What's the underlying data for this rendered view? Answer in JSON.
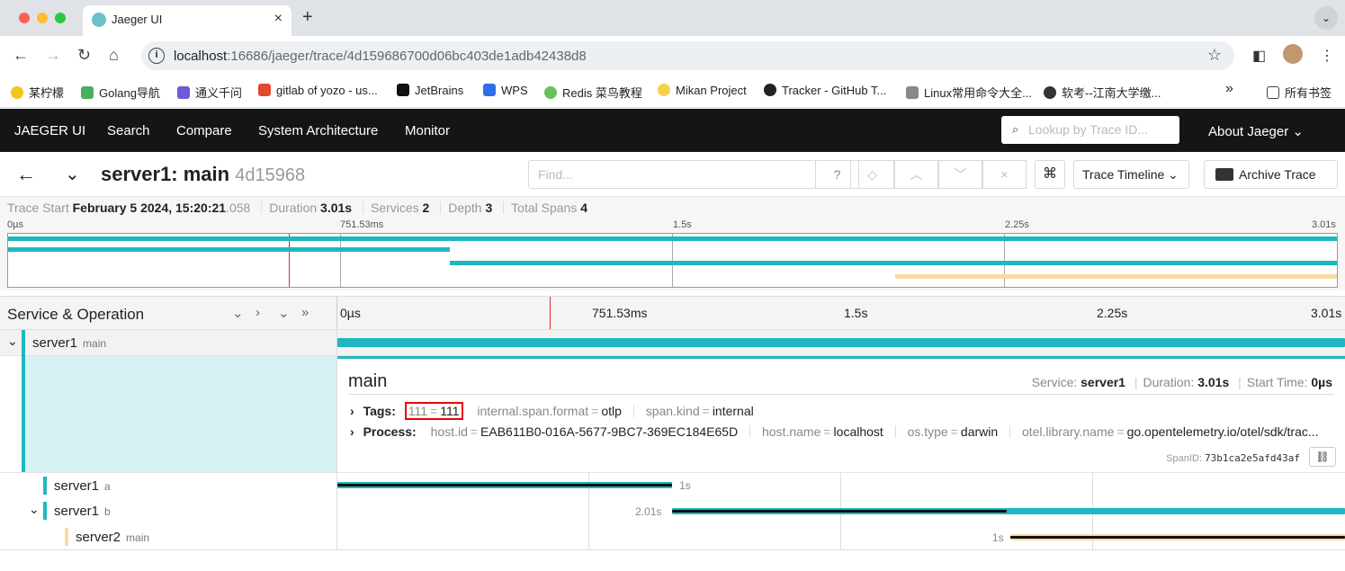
{
  "browser": {
    "tab_title": "Jaeger UI",
    "url_host": "localhost",
    "url_rest": ":16686/jaeger/trace/4d159686700d06bc403de1adb42438d8",
    "bookmarks": [
      "某柠檬",
      "Golang导航",
      "通义千问",
      "gitlab of yozo - us...",
      "JetBrains",
      "WPS",
      "Redis 菜鸟教程",
      "Mikan Project",
      "Tracker - GitHub T...",
      "Linux常用命令大全...",
      "软考--江南大学缴..."
    ],
    "more": "»",
    "all_bookmarks": "所有书签"
  },
  "nav": {
    "brand": "JAEGER UI",
    "items": [
      "Search",
      "Compare",
      "System Architecture",
      "Monitor"
    ],
    "lookup_placeholder": "Lookup by Trace ID...",
    "about": "About Jaeger"
  },
  "trace": {
    "title": "server1: main",
    "short_id": "4d15968",
    "find_placeholder": "Find...",
    "view_select": "Trace Timeline",
    "archive": "Archive Trace",
    "stats": {
      "start_label": "Trace Start",
      "start_value": "February 5 2024, 15:20:21",
      "start_ms": ".058",
      "duration_label": "Duration",
      "duration_value": "3.01s",
      "services_label": "Services",
      "services_value": "2",
      "depth_label": "Depth",
      "depth_value": "3",
      "spans_label": "Total Spans",
      "spans_value": "4"
    }
  },
  "minimap": {
    "ticks": [
      "0µs",
      "751.53ms",
      "1.5s",
      "2.25s",
      "3.01s"
    ]
  },
  "spans_header": {
    "label": "Service & Operation",
    "ticks": [
      "0µs",
      "751.53ms",
      "1.5s",
      "2.25s",
      "3.01s"
    ]
  },
  "spans": [
    {
      "service": "server1",
      "operation": "main",
      "start": 0,
      "end": 3.01,
      "color": "#1fb7bf"
    },
    {
      "service": "server1",
      "operation": "a",
      "start": 0,
      "end": 1.0,
      "color": "#1fb7bf",
      "label": "1s"
    },
    {
      "service": "server1",
      "operation": "b",
      "start": 1.0,
      "end": 3.01,
      "color": "#1fb7bf",
      "label": "2.01s"
    },
    {
      "service": "server2",
      "operation": "main",
      "start": 2.01,
      "end": 3.01,
      "color": "#f8dca1",
      "label": "1s"
    }
  ],
  "detail": {
    "name": "main",
    "service_label": "Service:",
    "service_value": "server1",
    "duration_label": "Duration:",
    "duration_value": "3.01s",
    "start_label": "Start Time:",
    "start_value": "0µs",
    "tags_label": "Tags:",
    "tags": [
      {
        "k": "111",
        "v": "111"
      },
      {
        "k": "internal.span.format",
        "v": "otlp"
      },
      {
        "k": "span.kind",
        "v": "internal"
      }
    ],
    "process_label": "Process:",
    "process": [
      {
        "k": "host.id",
        "v": "EAB611B0-016A-5677-9BC7-369EC184E65D"
      },
      {
        "k": "host.name",
        "v": "localhost"
      },
      {
        "k": "os.type",
        "v": "darwin"
      },
      {
        "k": "otel.library.name",
        "v": "go.opentelemetry.io/otel/sdk/trac..."
      }
    ],
    "spanid_label": "SpanID:",
    "spanid_value": "73b1ca2e5afd43af"
  }
}
